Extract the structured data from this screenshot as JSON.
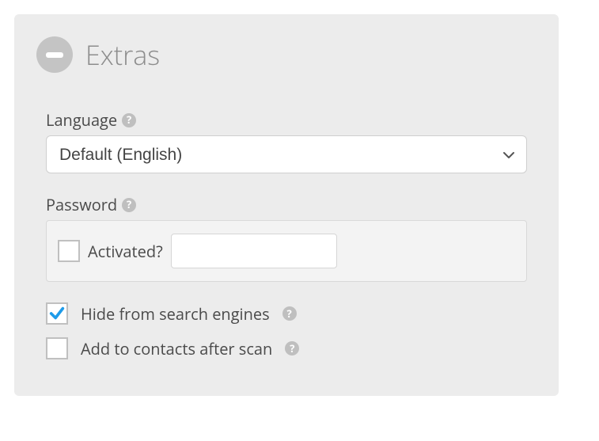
{
  "panel": {
    "title": "Extras"
  },
  "language": {
    "label": "Language",
    "selected": "Default (English)"
  },
  "password": {
    "label": "Password",
    "activated_label": "Activated?",
    "activated_checked": false,
    "value": ""
  },
  "options": {
    "hide_from_search": {
      "label": "Hide from search engines",
      "checked": true
    },
    "add_to_contacts": {
      "label": "Add to contacts after scan",
      "checked": false
    }
  },
  "help_glyph": "?"
}
